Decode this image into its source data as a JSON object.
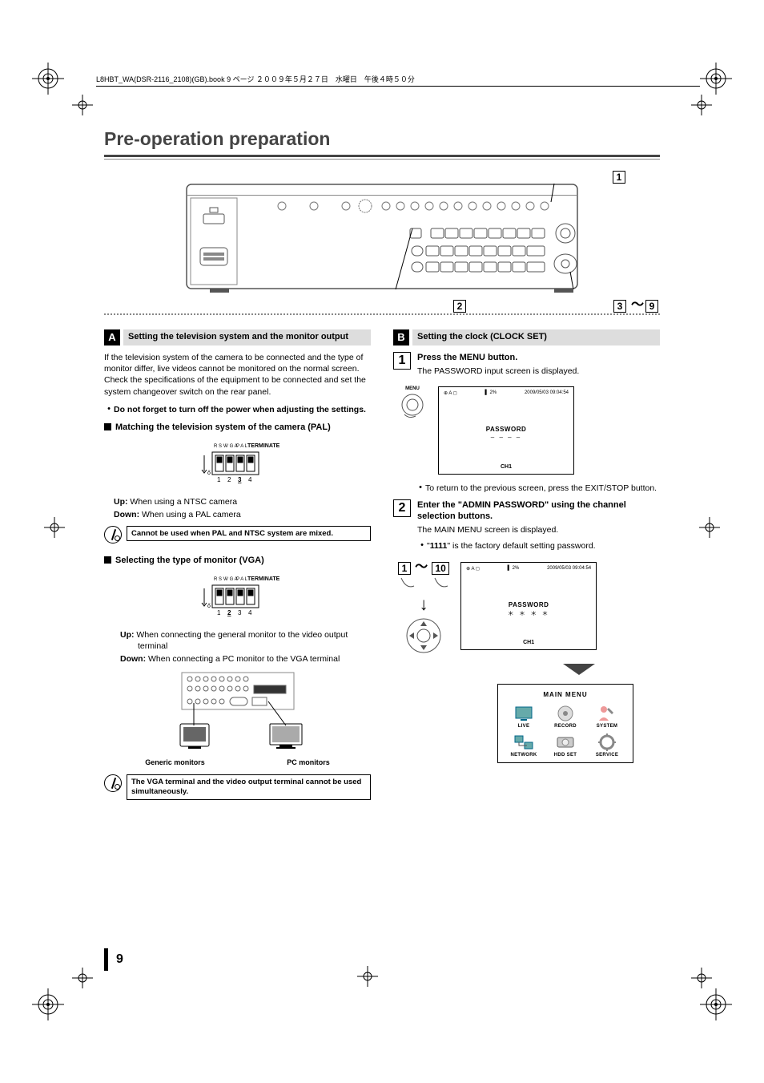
{
  "header": {
    "filename": "L8HBT_WA(DSR-2116_2108)(GB).book  9 ページ  ２００９年５月２７日　水曜日　午後４時５０分"
  },
  "title": "Pre-operation preparation",
  "callouts": {
    "c1": "1",
    "c2": "2",
    "c3": "3",
    "c9": "9"
  },
  "sectionA": {
    "letter": "A",
    "title": "Setting the television system and the monitor output",
    "intro": "If the television system of the camera to be connected and the type of monitor differ, live videos cannot be monitored on the normal screen. Check the specifications of the equipment to be connected and set the system changeover switch on the rear panel.",
    "bullet1": "Do not forget to turn off the power when adjusting the settings.",
    "sub1": "Matching the television system of the camera (PAL)",
    "dip_labels": {
      "rsv": "R\nS\nV",
      "vga": "V\nG\nA",
      "pal": "P\nA\nL",
      "term": "TERMINATE",
      "n1": "1",
      "n2": "2",
      "n3": "3",
      "n4": "4"
    },
    "up1_k": "Up:",
    "up1_v": " When using a NTSC camera",
    "dn1_k": "Down:",
    "dn1_v": " When using a PAL camera",
    "note1": "Cannot be used when PAL and NTSC system are mixed.",
    "sub2": "Selecting the type of monitor (VGA)",
    "up2_k": "Up:",
    "up2_v": " When connecting the general monitor to the video output terminal",
    "dn2_k": "Down:",
    "dn2_v": " When connecting a PC monitor to the VGA terminal",
    "mon_generic": "Generic monitors",
    "mon_pc": "PC monitors",
    "note2": "The VGA terminal and the video output terminal cannot be used simultaneously."
  },
  "sectionB": {
    "letter": "B",
    "title": "Setting the clock (CLOCK SET)",
    "step1_num": "1",
    "step1_title": "Press the MENU button.",
    "step1_text": "The PASSWORD input screen is displayed.",
    "menu_label": "MENU",
    "screen1": {
      "status_left": "⊕ A ◻",
      "status_mid": "2%",
      "status_right": "2009/05/03 09:04:54",
      "center": "PASSWORD",
      "dash": "– – – –",
      "ch": "CH1"
    },
    "bulletB1": "To return to the previous screen, press the EXIT/STOP button.",
    "step2_num": "2",
    "step2_title": "Enter the \"ADMIN PASSWORD\" using the channel selection buttons.",
    "step2_text": "The MAIN MENU screen is displayed.",
    "bulletB2a": "\"",
    "bulletB2b": "1111",
    "bulletB2c": "\" is the factory default setting password.",
    "range1": "1",
    "range10": "10",
    "screen2": {
      "status_left": "⊕ A ◻",
      "status_mid": "2%",
      "status_right": "2009/05/03 09:04:54",
      "center": "PASSWORD",
      "dash": "＊ ＊ ＊ ＊",
      "ch": "CH1"
    },
    "menu": {
      "title": "MAIN MENU",
      "items": [
        "LIVE",
        "RECORD",
        "SYSTEM",
        "NETWORK",
        "HDD SET",
        "SERVICE"
      ]
    }
  },
  "page_number": "9"
}
